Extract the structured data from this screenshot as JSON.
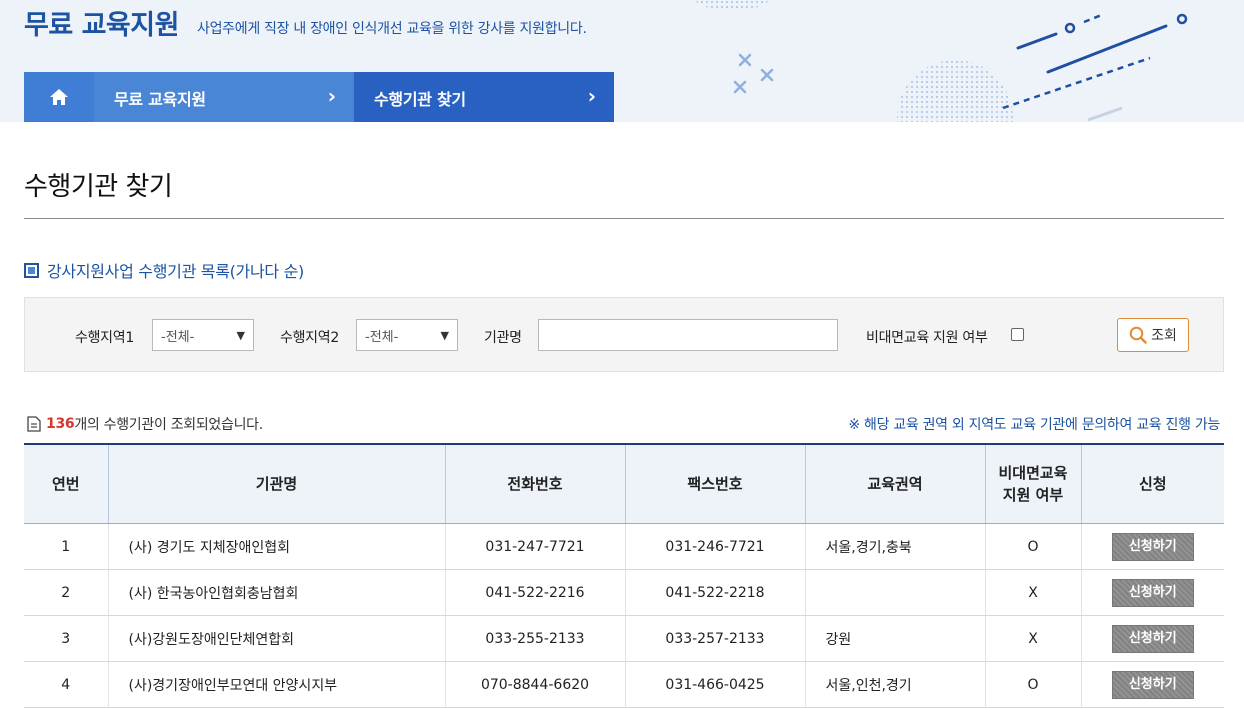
{
  "header": {
    "title": "무료 교육지원",
    "subtitle": "사업주에게 직장 내 장애인 인식개선 교육을 위한 강사를 지원합니다."
  },
  "breadcrumb": {
    "home_icon": "home-icon",
    "items": [
      {
        "label": "무료 교육지원"
      },
      {
        "label": "수행기관 찾기"
      }
    ]
  },
  "page_title": "수행기관 찾기",
  "section_title": "강사지원사업 수행기관 목록(가나다 순)",
  "search": {
    "region1_label": "수행지역1",
    "region1_value": "-전체-",
    "region2_label": "수행지역2",
    "region2_value": "-전체-",
    "org_label": "기관명",
    "org_value": "",
    "remote_label": "비대면교육 지원 여부",
    "remote_checked": false,
    "search_button": "조회"
  },
  "result": {
    "count": "136",
    "suffix": "개의 수행기관이 조회되었습니다.",
    "note": "※ 해당 교육 권역 외 지역도 교육 기관에 문의하여 교육 진행 가능"
  },
  "table": {
    "headers": {
      "no": "연번",
      "name": "기관명",
      "phone": "전화번호",
      "fax": "팩스번호",
      "region": "교육권역",
      "remote_line1": "비대면교육",
      "remote_line2": "지원 여부",
      "apply": "신청"
    },
    "apply_label": "신청하기",
    "rows": [
      {
        "no": "1",
        "name": "(사) 경기도 지체장애인협회",
        "phone": "031-247-7721",
        "fax": "031-246-7721",
        "region": "서울,경기,충북",
        "remote": "O"
      },
      {
        "no": "2",
        "name": "(사) 한국농아인협회충남협회",
        "phone": "041-522-2216",
        "fax": "041-522-2218",
        "region": "",
        "remote": "X"
      },
      {
        "no": "3",
        "name": "(사)강원도장애인단체연합회",
        "phone": "033-255-2133",
        "fax": "033-257-2133",
        "region": "강원",
        "remote": "X"
      },
      {
        "no": "4",
        "name": "(사)경기장애인부모연대 안양시지부",
        "phone": "070-8844-6620",
        "fax": "031-466-0425",
        "region": "서울,인천,경기",
        "remote": "O"
      }
    ]
  }
}
